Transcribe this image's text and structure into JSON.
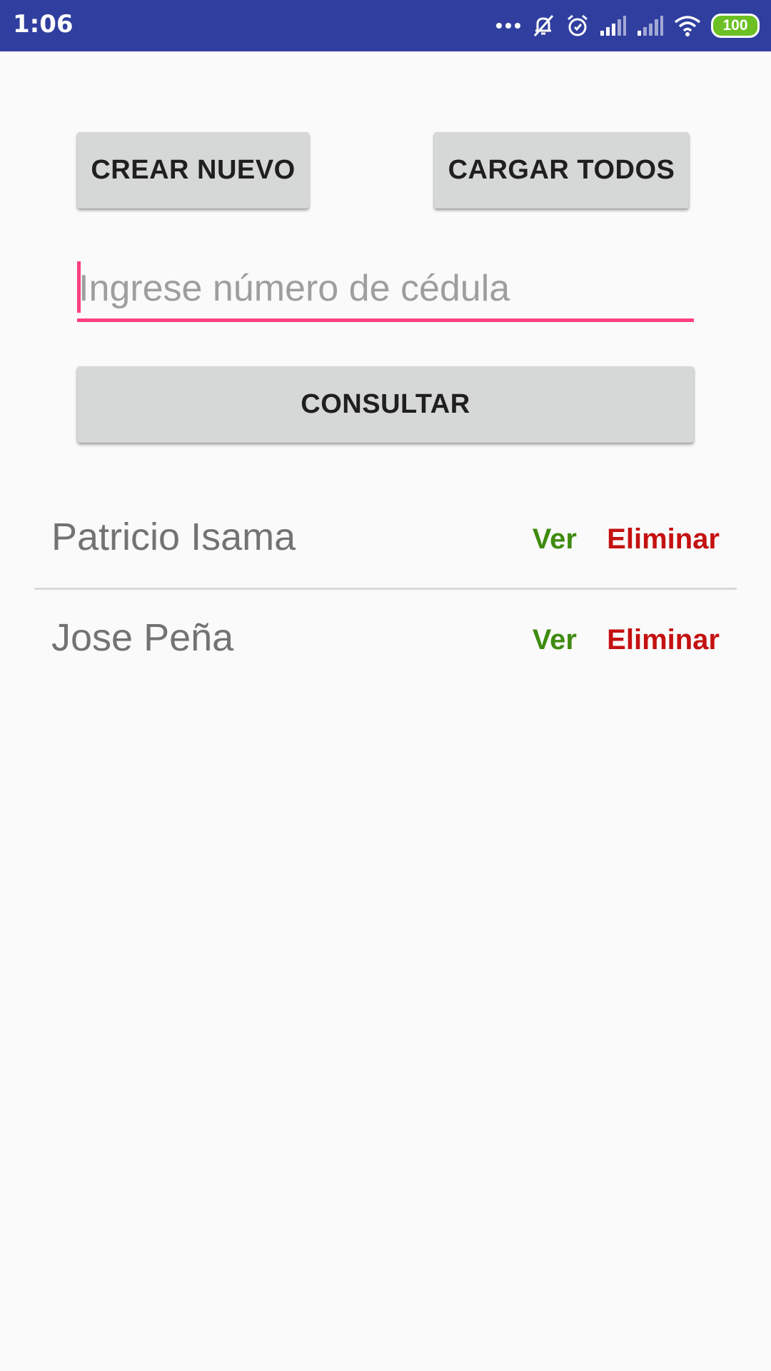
{
  "status_bar": {
    "time": "1:06",
    "battery": "100",
    "icons": [
      "more-dots-icon",
      "silent-bell-icon",
      "alarm-icon",
      "signal-icon",
      "signal-icon",
      "wifi-icon",
      "battery-icon"
    ],
    "colors": {
      "background": "#303f9f",
      "battery_fill": "#6cc024"
    }
  },
  "toolbar": {
    "create_label": "CREAR NUEVO",
    "load_all_label": "CARGAR TODOS"
  },
  "search": {
    "value": "",
    "placeholder": "Ingrese número de cédula"
  },
  "query_button": {
    "label": "CONSULTAR"
  },
  "people": [
    {
      "name": "Patricio Isama",
      "view_label": "Ver",
      "delete_label": "Eliminar"
    },
    {
      "name": "Jose Peña",
      "view_label": "Ver",
      "delete_label": "Eliminar"
    }
  ],
  "colors": {
    "accent": "#ff4081",
    "view_action": "#3f8b10",
    "delete_action": "#c51111",
    "button_bg": "#d6d7d7"
  }
}
